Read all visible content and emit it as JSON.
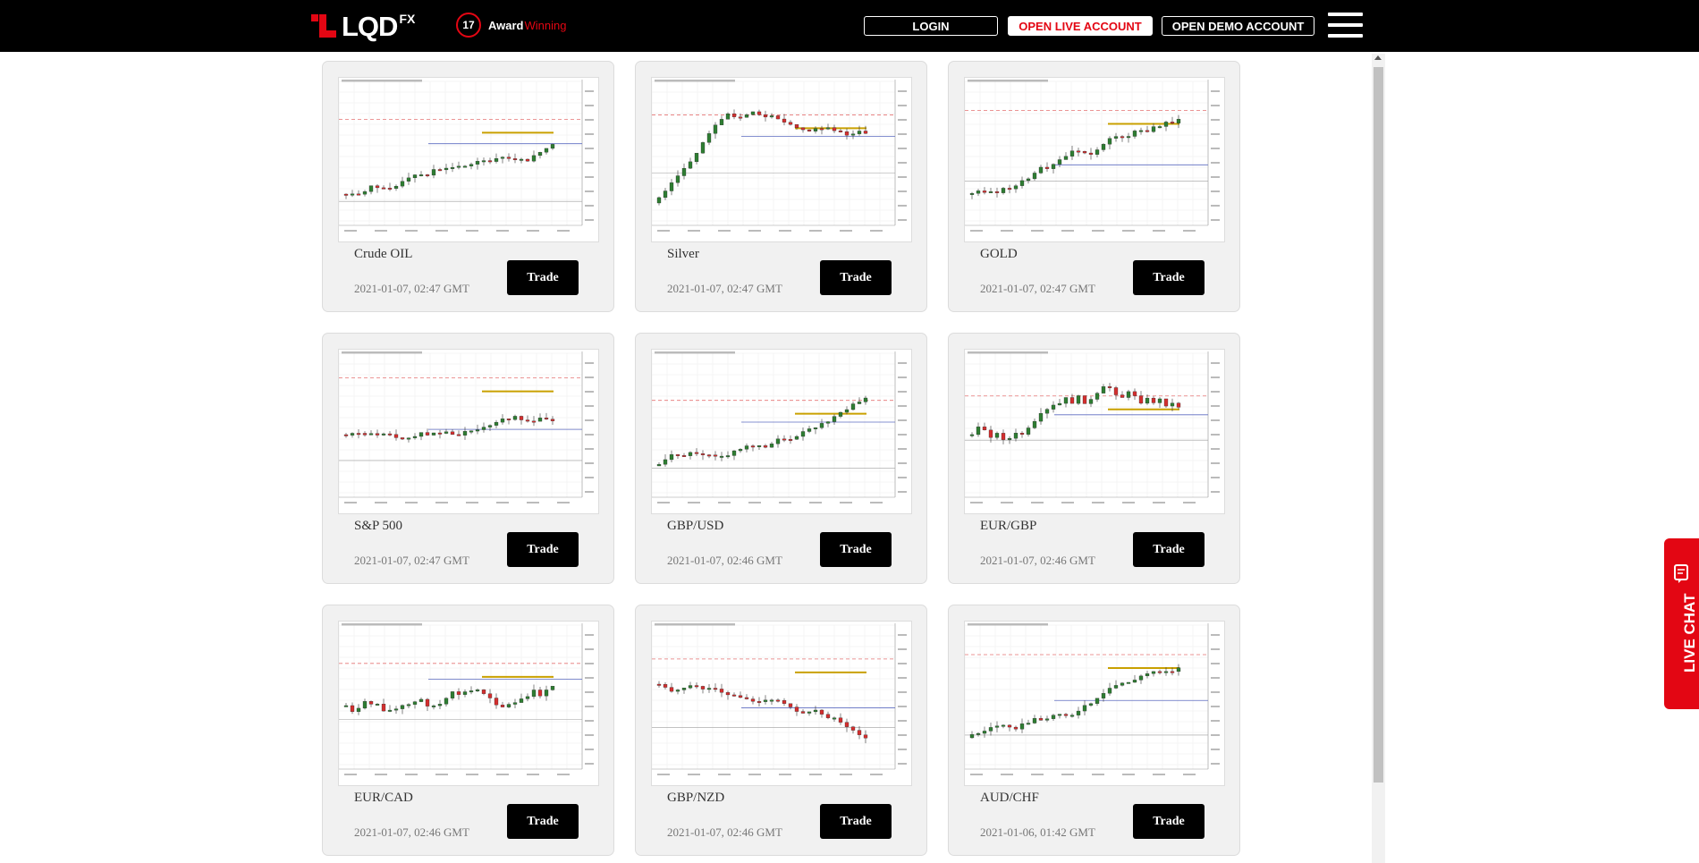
{
  "header": {
    "logo_text": "LQD",
    "logo_sup": "FX",
    "award_number": "17",
    "award_text1": "Award",
    "award_text2": "Winning",
    "login_label": "LOGIN",
    "live_label": "OPEN LIVE ACCOUNT",
    "demo_label": "OPEN DEMO ACCOUNT",
    "menu_icon": "hamburger-menu-icon"
  },
  "colors": {
    "brand_red": "#e30613",
    "candle_up": "#2e7d32",
    "candle_down": "#d32f2f",
    "target_line": "#c9a000"
  },
  "cards": [
    {
      "name": "Crude OIL",
      "date": "2021-01-07, 02:47 GMT",
      "trade": "Trade"
    },
    {
      "name": "Silver",
      "date": "2021-01-07, 02:47 GMT",
      "trade": "Trade"
    },
    {
      "name": "GOLD",
      "date": "2021-01-07, 02:47 GMT",
      "trade": "Trade"
    },
    {
      "name": "S&P 500",
      "date": "2021-01-07, 02:47 GMT",
      "trade": "Trade"
    },
    {
      "name": "GBP/USD",
      "date": "2021-01-07, 02:46 GMT",
      "trade": "Trade"
    },
    {
      "name": "EUR/GBP",
      "date": "2021-01-07, 02:46 GMT",
      "trade": "Trade"
    },
    {
      "name": "EUR/CAD",
      "date": "2021-01-07, 02:46 GMT",
      "trade": "Trade"
    },
    {
      "name": "GBP/NZD",
      "date": "2021-01-07, 02:46 GMT",
      "trade": "Trade"
    },
    {
      "name": "AUD/CHF",
      "date": "2021-01-06, 01:42 GMT",
      "trade": "Trade"
    }
  ],
  "live_chat": {
    "label": "LIVE CHAT",
    "icon": "chat-icon"
  }
}
